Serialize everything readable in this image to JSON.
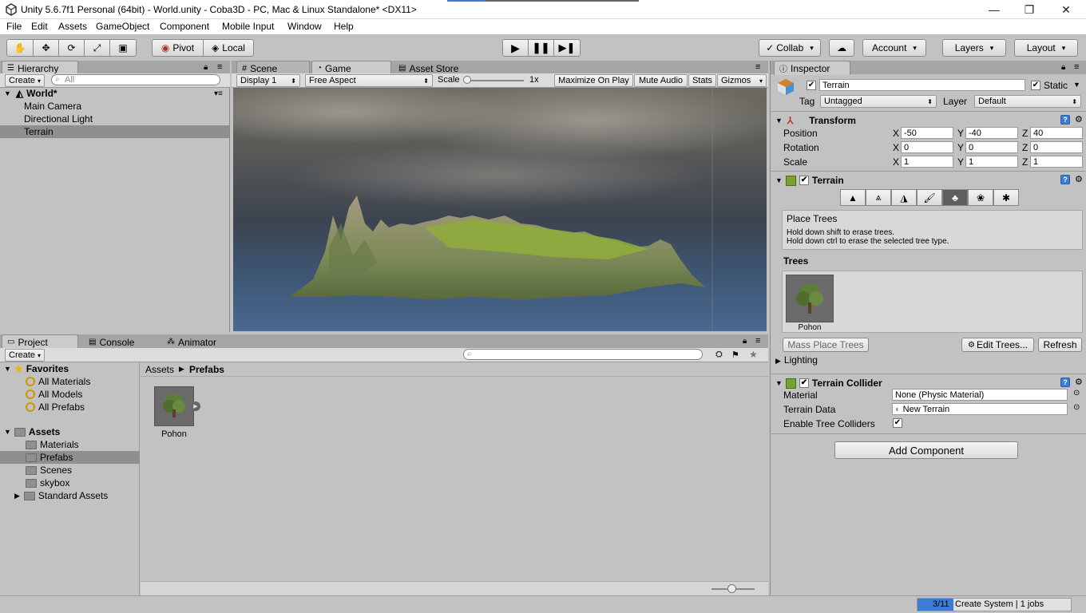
{
  "window": {
    "title": "Unity 5.6.7f1 Personal (64bit) - World.unity - Coba3D - PC, Mac & Linux Standalone* <DX11>",
    "minimize": "—",
    "maximize": "❐",
    "close": "✕"
  },
  "menu": [
    "File",
    "Edit",
    "Assets",
    "GameObject",
    "Component",
    "Mobile Input",
    "Window",
    "Help"
  ],
  "toolbar": {
    "pivot": "Pivot",
    "local": "Local",
    "collab": "Collab",
    "account": "Account",
    "layers": "Layers",
    "layout": "Layout"
  },
  "hierarchy": {
    "tab": "Hierarchy",
    "create": "Create",
    "search_placeholder": "All",
    "scene": "World*",
    "items": [
      "Main Camera",
      "Directional Light",
      "Terrain"
    ]
  },
  "center_tabs": {
    "scene": "Scene",
    "game": "Game",
    "asset_store": "Asset Store"
  },
  "game_bar": {
    "display": "Display 1",
    "aspect": "Free Aspect",
    "scale_label": "Scale",
    "scale_value": "1x",
    "maximize": "Maximize On Play",
    "mute": "Mute Audio",
    "stats": "Stats",
    "gizmos": "Gizmos"
  },
  "project": {
    "tabs": [
      "Project",
      "Console",
      "Animator"
    ],
    "create": "Create",
    "favorites": "Favorites",
    "favorite_items": [
      "All Materials",
      "All Models",
      "All Prefabs"
    ],
    "assets": "Assets",
    "asset_folders": [
      "Materials",
      "Prefabs",
      "Scenes",
      "skybox",
      "Standard Assets"
    ],
    "breadcrumb": [
      "Assets",
      "Prefabs"
    ],
    "items": [
      {
        "name": "Pohon"
      }
    ]
  },
  "inspector": {
    "tab": "Inspector",
    "object_name": "Terrain",
    "static": "Static",
    "tag_label": "Tag",
    "tag_value": "Untagged",
    "layer_label": "Layer",
    "layer_value": "Default",
    "transform": {
      "title": "Transform",
      "rows": [
        {
          "label": "Position",
          "x": "-50",
          "y": "-40",
          "z": "40"
        },
        {
          "label": "Rotation",
          "x": "0",
          "y": "0",
          "z": "0"
        },
        {
          "label": "Scale",
          "x": "1",
          "y": "1",
          "z": "1"
        }
      ]
    },
    "terrain": {
      "title": "Terrain",
      "help_title": "Place Trees",
      "help_line1": "Hold down shift to erase trees.",
      "help_line2": "Hold down ctrl to erase the selected tree type.",
      "trees_label": "Trees",
      "tree_name": "Pohon",
      "mass_place": "Mass Place Trees",
      "edit_trees": "Edit Trees...",
      "refresh": "Refresh",
      "lighting": "Lighting"
    },
    "collider": {
      "title": "Terrain Collider",
      "material_label": "Material",
      "material_value": "None (Physic Material)",
      "data_label": "Terrain Data",
      "data_value": "New Terrain",
      "tree_colliders_label": "Enable Tree Colliders"
    },
    "add_component": "Add Component"
  },
  "status": {
    "progress": "3/11",
    "text": "Create System | 1 jobs"
  },
  "colors": {
    "accent": "#3d7bd5",
    "panel": "#c2c2c2",
    "selected": "#8f8f8f"
  }
}
